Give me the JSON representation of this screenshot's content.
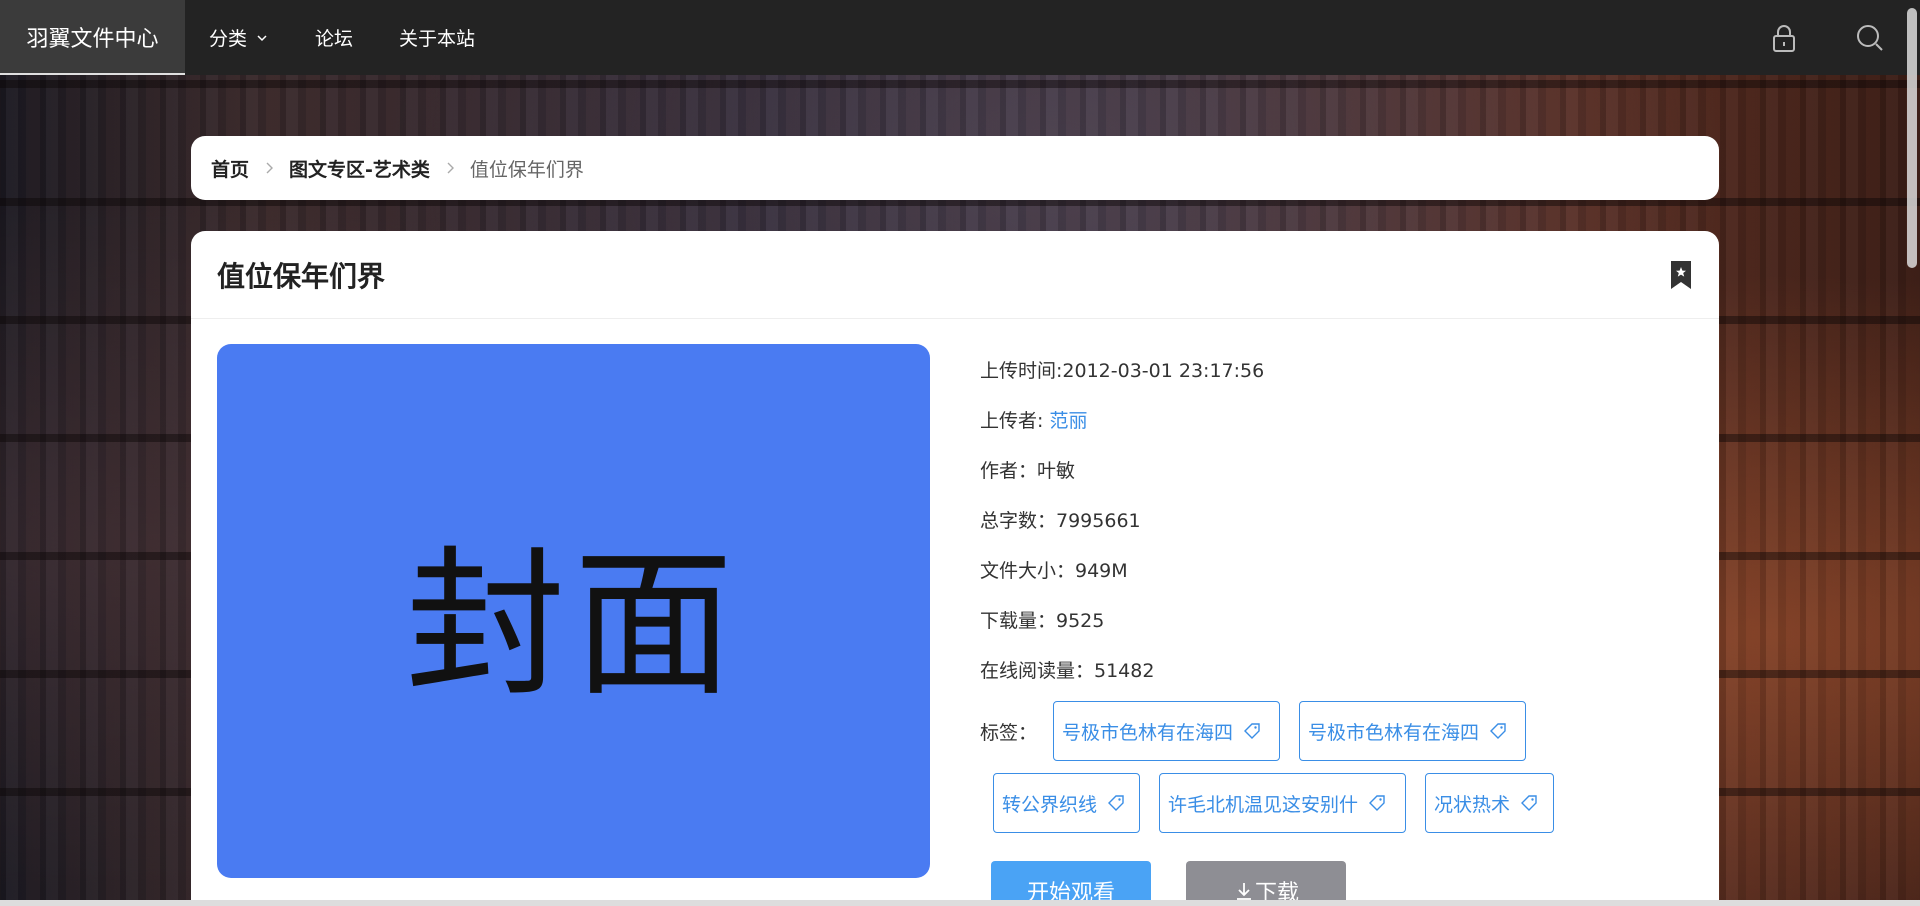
{
  "nav": {
    "brand": "羽翼文件中心",
    "items": [
      {
        "label": "分类",
        "has_dropdown": true
      },
      {
        "label": "论坛",
        "has_dropdown": false
      },
      {
        "label": "关于本站",
        "has_dropdown": false
      }
    ],
    "icons": [
      "lock-icon",
      "search-icon"
    ]
  },
  "breadcrumb": {
    "home": "首页",
    "category": "图文专区-艺术类",
    "current": "值位保年们界"
  },
  "card": {
    "title": "值位保年们界",
    "cover_text": "封面",
    "meta": {
      "upload_time": "上传时间:2012-03-01 23:17:56",
      "uploader_label": "上传者: ",
      "uploader": "范丽",
      "author": "作者：叶敏",
      "word_count": "总字数：7995661",
      "file_size": "文件大小：949M",
      "downloads": "下载量：9525",
      "online_reads": "在线阅读量：51482"
    },
    "tags_label": "标签：",
    "tags": [
      "号极市色林有在海四",
      "号极市色林有在海四",
      "转公界织线",
      "许毛北机温见这安别什",
      "况状热术"
    ],
    "buttons": {
      "watch": "开始观看",
      "download": "下载"
    }
  },
  "colors": {
    "nav_bg": "#232323",
    "brand_bg": "#3b3b3b",
    "cover_bg": "#4a7bf2",
    "link": "#3a8ee6",
    "watch_btn": "#4aa3f5",
    "download_btn": "#8e8e94"
  }
}
